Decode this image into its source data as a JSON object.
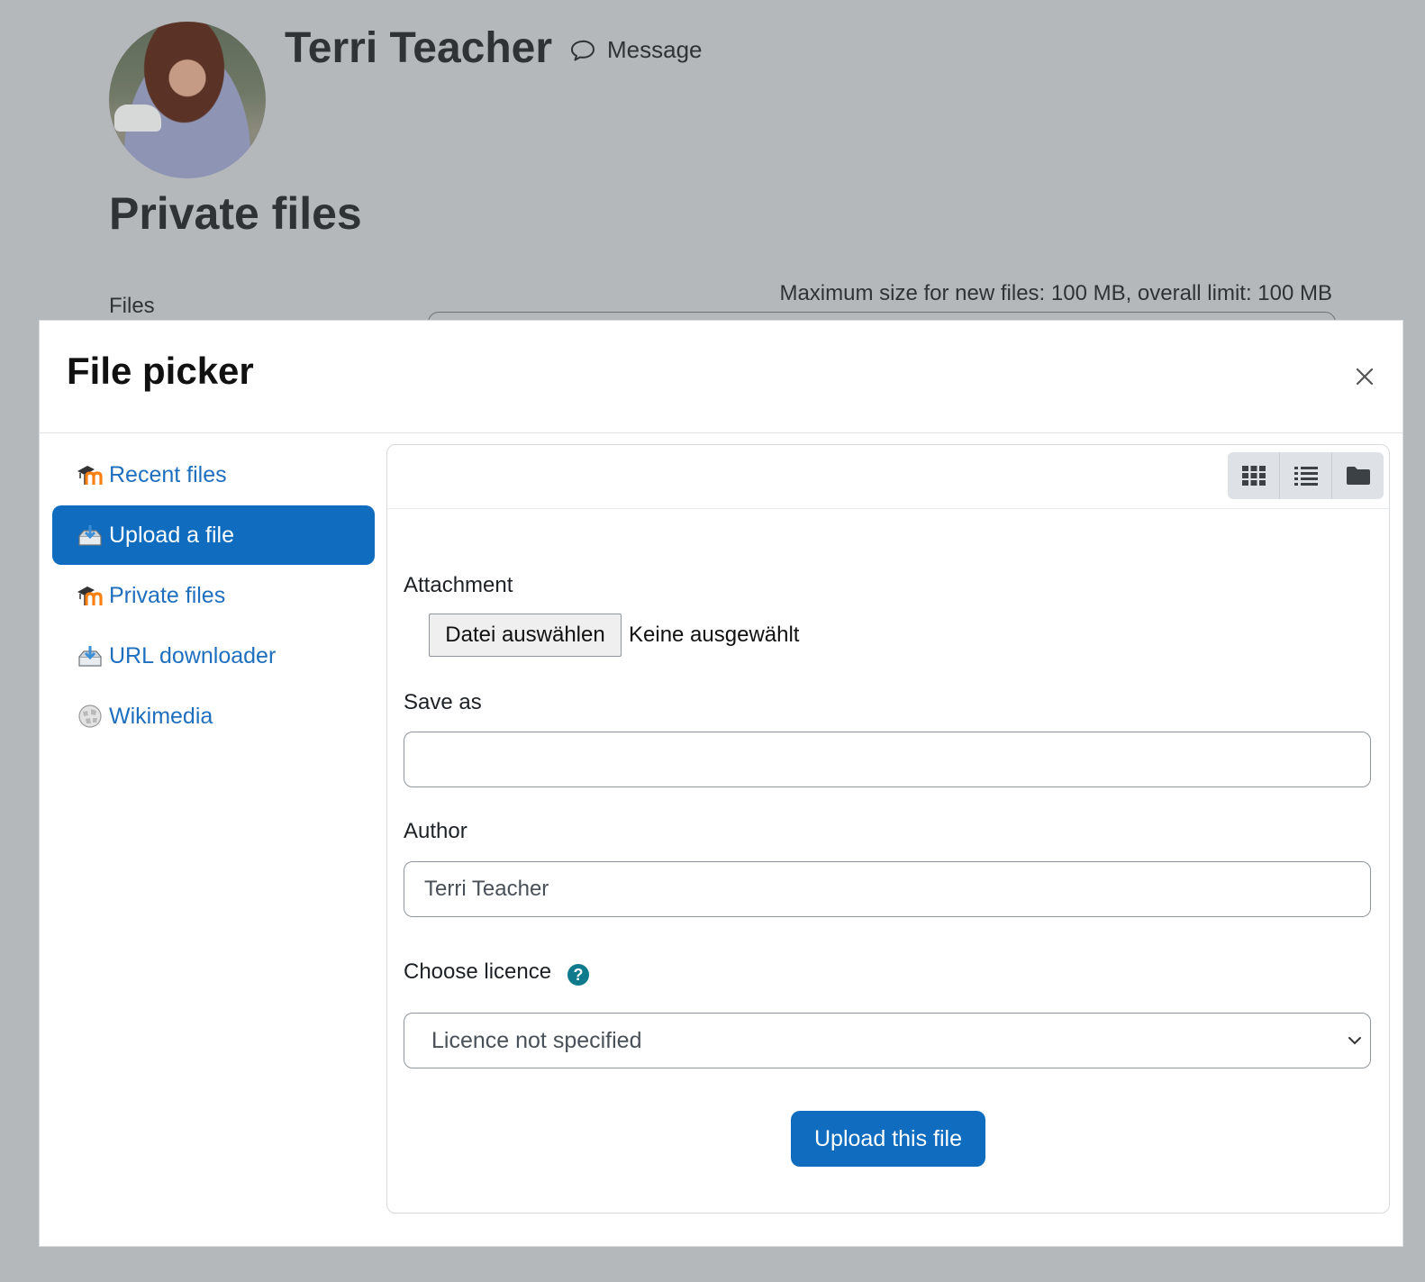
{
  "profile": {
    "name": "Terri Teacher",
    "message_label": "Message"
  },
  "page": {
    "heading": "Private files",
    "files_label": "Files",
    "max_size_text": "Maximum size for new files: 100 MB, overall limit: 100 MB"
  },
  "dialog": {
    "title": "File picker",
    "repositories": [
      {
        "label": "Recent files",
        "icon": "moodle-icon"
      },
      {
        "label": "Upload a file",
        "icon": "upload-icon",
        "active": true
      },
      {
        "label": "Private files",
        "icon": "moodle-icon"
      },
      {
        "label": "URL downloader",
        "icon": "download-icon"
      },
      {
        "label": "Wikimedia",
        "icon": "wikimedia-icon"
      }
    ],
    "view_modes": [
      "grid-view-icon",
      "list-view-icon",
      "folder-view-icon"
    ],
    "form": {
      "attachment_label": "Attachment",
      "file_button_label": "Datei auswählen",
      "file_status": "Keine ausgewählt",
      "save_as_label": "Save as",
      "save_as_value": "",
      "author_label": "Author",
      "author_value": "Terri Teacher",
      "licence_label": "Choose licence",
      "licence_value": "Licence not specified",
      "submit_label": "Upload this file"
    }
  },
  "colors": {
    "primary": "#0f6cbf",
    "link": "#1f6fbf",
    "backdrop": "#b4b8bb",
    "help": "#0f7a8c"
  }
}
